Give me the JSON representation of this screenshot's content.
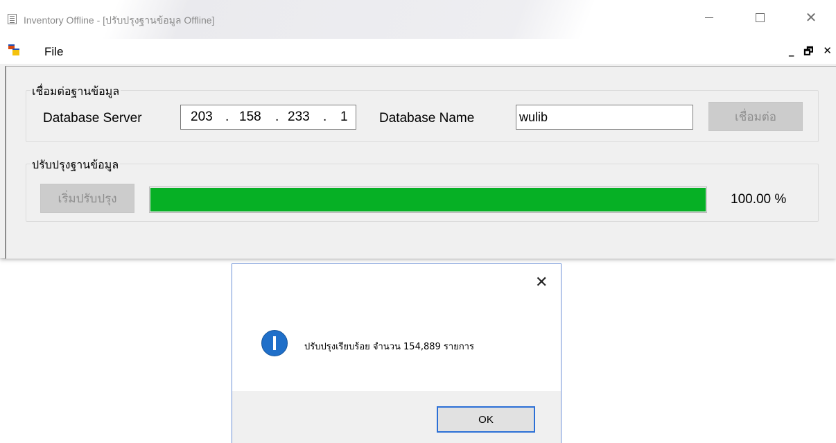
{
  "window": {
    "title": "Inventory Offline - [ปรับปรุงฐานข้อมูล Offline]",
    "icon": "app-document-icon"
  },
  "menu": {
    "file_label": "File",
    "mdi_minimize": "_",
    "mdi_restore": "🗗",
    "mdi_close": "✕"
  },
  "connection_group": {
    "legend": "เชื่อมต่อฐานข้อมูล",
    "server_label": "Database Server",
    "server_ip": [
      "203",
      "158",
      "233",
      "1"
    ],
    "ip_separator": ".",
    "dbname_label": "Database Name",
    "dbname_value": "wulib",
    "connect_button": "เชื่อมต่อ"
  },
  "update_group": {
    "legend": "ปรับปรุงฐานข้อมูล",
    "start_button": "เริ่มปรับปรุง",
    "progress_fraction": 1.0,
    "percent_text": "100.00 %",
    "progress_color": "#06b025"
  },
  "message_box": {
    "icon": "info-icon",
    "text": "ปรับปรุงเรียบร้อย จำนวน 154,889 รายการ",
    "ok_button": "OK",
    "accent_color": "#2b6fd6"
  }
}
